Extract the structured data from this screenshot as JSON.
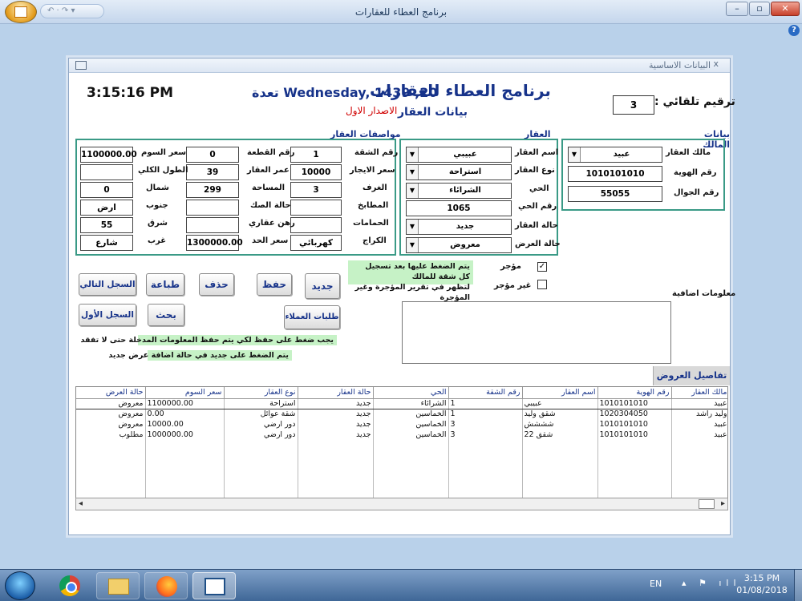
{
  "window": {
    "title": "برنامج العطاء للعقارات"
  },
  "form": {
    "title": "البيانات الاساسية",
    "header": {
      "main_title": "برنامج العطاء للعقارات",
      "date": "Wednesday, 1439 ,20 تعدة",
      "time": "3:15:16 PM",
      "subtitle": "بيانات العقار",
      "version": "الاصدار الاول",
      "seq_label": "ترقيم تلقائي :",
      "seq_value": "3"
    },
    "owner": {
      "section_title": "بيانات المالك",
      "owner_label": "مالك العقار",
      "owner_value": "عبيد",
      "id_label": "رقم الهوية",
      "id_value": "1010101010",
      "mobile_label": "رقم الجوال",
      "mobile_value": "55055"
    },
    "property": {
      "section_title": "العقار",
      "name_label": "اسم العقار",
      "name_value": "عبيبي",
      "type_label": "نوع العقار",
      "type_value": "استراحة",
      "district_label": "الحي",
      "district_value": "الشرائاء",
      "district_no_label": "رقم الحي",
      "district_no_value": "1065",
      "status_label": "حالة العقار",
      "status_value": "جديد",
      "offer_status_label": "حالة العرض",
      "offer_status_value": "معروض"
    },
    "specs": {
      "section_title": "مواصفات العقار",
      "col1": [
        {
          "label": "رقم الشقة",
          "value": "1"
        },
        {
          "label": "سعر الايجار",
          "value": "10000"
        },
        {
          "label": "الغرف",
          "value": "3"
        },
        {
          "label": "المطابخ",
          "value": ""
        },
        {
          "label": "الحمامات",
          "value": ""
        },
        {
          "label": "الكراج",
          "value": "كهربائي"
        }
      ],
      "col2": [
        {
          "label": "رقم القطعة",
          "value": "0"
        },
        {
          "label": "عمر العقار",
          "value": "39"
        },
        {
          "label": "المساحة",
          "value": "299"
        },
        {
          "label": "حالة الصك",
          "value": ""
        },
        {
          "label": "رهن عقاري",
          "value": ""
        },
        {
          "label": "سعر الحد",
          "value": "1300000.00"
        }
      ],
      "col3": [
        {
          "label": "سعر السوم",
          "value": "1100000.00"
        },
        {
          "label": "الطول الكلي",
          "value": ""
        },
        {
          "label": "شمال",
          "value": "0"
        },
        {
          "label": "جنوب",
          "value": "ارض"
        },
        {
          "label": "شرق",
          "value": "55"
        },
        {
          "label": "غرب",
          "value": "شارع"
        }
      ]
    },
    "rented": {
      "note": "يتم الضغط عليها بعد تسجيل كل شقة للمالك\nلتظهر في تقرير المؤجرة وغير المؤجرة",
      "rented_label": "مؤجر",
      "rented_checked": true,
      "not_rented_label": "غير مؤجر",
      "not_rented_checked": false
    },
    "extra_info_label": "معلومات اضافية",
    "buttons": {
      "new": "جديد",
      "save": "حفظ",
      "delete": "حذف",
      "print": "طباعة",
      "next": "السجل التالي",
      "first": "السجل الأول",
      "search": "بحث",
      "clients": "طلبات العملاء"
    },
    "notes": {
      "save_note": "يجب ضغط على حفظ لكي يتم حفظ المعلومات المدخلة حتى لا تفقد",
      "new_note": "يتم الضغط على جديد في حالة اضافة عرض جديد"
    },
    "offers": {
      "title": "تفاصيل العروض",
      "columns": [
        "مالك العقار",
        "رقم الهوية",
        "اسم العقار",
        "رقم الشقة",
        "الحي",
        "حالة العقار",
        "نوع العقار",
        "سعر السوم",
        "حالة العرض"
      ],
      "rows": [
        [
          "عبيد",
          "1010101010",
          "عبيبي",
          "1",
          "الشرائاء",
          "جديد",
          "استراحة",
          "1100000.00",
          "معروض"
        ],
        [
          "وليد راشد",
          "1020304050",
          "شقق وليد",
          "1",
          "الخماسين",
          "جديد",
          "شقة عوائل",
          "0.00",
          "معروض"
        ],
        [
          "عبيد",
          "1010101010",
          "شششش",
          "3",
          "الخماسين",
          "جديد",
          "دور ارضي",
          "10000.00",
          "معروض"
        ],
        [
          "عبيد",
          "1010101010",
          "شقق 22",
          "3",
          "الخماسين",
          "جديد",
          "دور ارضي",
          "1000000.00",
          "مطلوب"
        ]
      ]
    }
  },
  "taskbar": {
    "lang": "EN",
    "time": "3:15 PM",
    "date": "01/08/2018"
  },
  "colors": {
    "accent": "#17338a",
    "group_border": "#3a9a86",
    "note_bg": "#c6f2c6",
    "version": "#d00000"
  },
  "icons": [
    "office-orb-icon",
    "help-icon",
    "form-icon",
    "start-orb-icon",
    "chrome-icon",
    "folder-icon",
    "firefox-icon",
    "access-icon",
    "checkbox-icon",
    "dropdown-arrow-icon"
  ]
}
